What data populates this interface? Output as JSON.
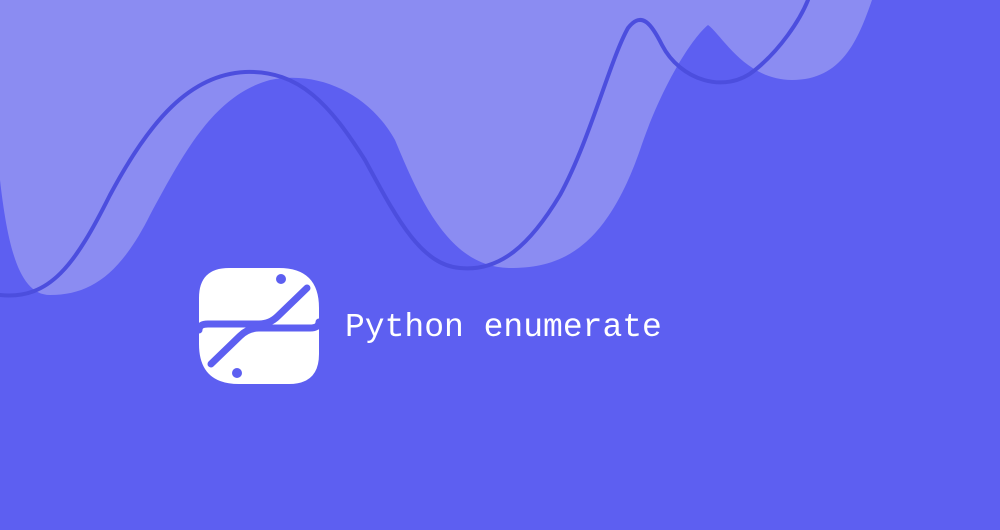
{
  "banner": {
    "title": "Python enumerate",
    "logo_icon": "python-logo-icon"
  },
  "colors": {
    "background": "#5d5ff1",
    "wave_fill": "#8b8cf2",
    "wave_line": "#4c4ede",
    "foreground": "#ffffff"
  }
}
